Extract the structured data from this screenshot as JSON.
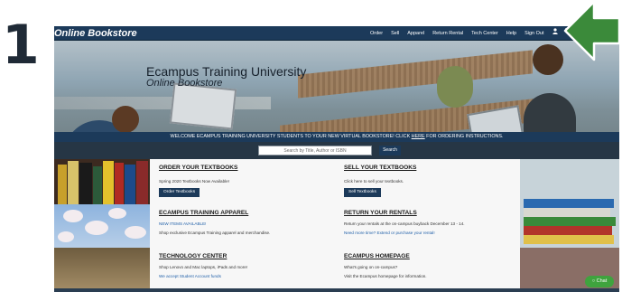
{
  "step": {
    "number": "1"
  },
  "header": {
    "brand": "Online Bookstore",
    "nav": [
      "Order",
      "Sell",
      "Apparel",
      "Return Rental",
      "Tech Center",
      "Help",
      "Sign Out"
    ],
    "icons": [
      "user-icon",
      "cart-icon"
    ]
  },
  "hero": {
    "title": "Ecampus Training University",
    "subtitle": "Online Bookstore"
  },
  "banner": {
    "text_before": "WELCOME ECAMPUS TRAINING UNIVERSITY STUDENTS TO YOUR NEW VIRTUAL BOOKSTORE!  CLICK ",
    "link": "HERE",
    "text_after": " FOR ORDERING INSTRUCTIONS."
  },
  "search": {
    "placeholder": "Search by Title, Author or ISBN",
    "button": "Search"
  },
  "panels": {
    "order": {
      "title": "ORDER YOUR TEXTBOOKS",
      "text": "Spring 2020 Textbooks Now Available!",
      "button": "Order Textbooks"
    },
    "sell": {
      "title": "SELL YOUR TEXTBOOKS",
      "text": "Click here to sell your textbooks.",
      "button": "Sell Textbooks"
    },
    "apparel": {
      "title": "ECAMPUS TRAINING APPAREL",
      "link": "NEW ITEMS AVAILABLE!",
      "text": "Shop exclusive Ecampus Training apparel and merchandise."
    },
    "rentals": {
      "title": "RETURN YOUR RENTALS",
      "text": "Return your rentals at the on-campus buyback December 13 - 14.",
      "link": "Need more time? Extend or purchase your rental!"
    },
    "tech": {
      "title": "TECHNOLOGY CENTER",
      "text": "Shop Lenovo and Mac laptops, iPads and more!",
      "link": "We accept Student Account funds"
    },
    "homepage": {
      "title": "ECAMPUS HOMEPAGE",
      "text": "What's going on on-campus?",
      "text2": "Visit the Ecampus homepage for information."
    }
  },
  "chat": {
    "label": "Chat"
  },
  "colors": {
    "nav": "#1c3a5a",
    "arrow": "#3b8a3a",
    "chat": "#3fa33e"
  }
}
